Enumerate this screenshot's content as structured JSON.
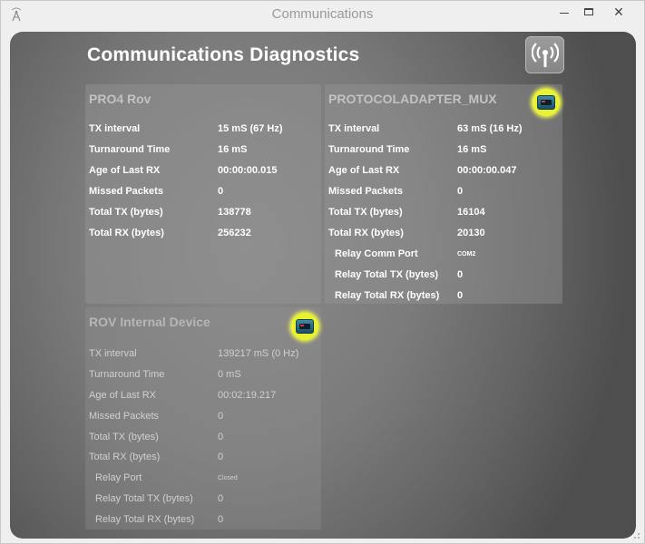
{
  "window": {
    "title": "Communications",
    "icons": {
      "app": "antenna-app-icon",
      "minimize": "minimize-icon",
      "maximize": "maximize-icon",
      "close": "close-icon"
    },
    "close_glyph": "✕"
  },
  "header": {
    "title": "Communications Diagnostics",
    "signal_icon": "wireless-signal-icon"
  },
  "panels": [
    {
      "title": "PRO4 Rov",
      "rows": [
        {
          "label": "TX interval",
          "value": "15 mS (67 Hz)"
        },
        {
          "label": "Turnaround Time",
          "value": "16 mS"
        },
        {
          "label": "Age of Last RX",
          "value": "00:00:00.015"
        },
        {
          "label": "Missed Packets",
          "value": "0"
        },
        {
          "label": "Total TX (bytes)",
          "value": "138778"
        },
        {
          "label": "Total RX (bytes)",
          "value": "256232"
        }
      ]
    },
    {
      "title": "PROTOCOLADAPTER_MUX",
      "terminal_icon": "terminal-icon",
      "rows": [
        {
          "label": "TX interval",
          "value": "63 mS (16 Hz)"
        },
        {
          "label": "Turnaround Time",
          "value": "16 mS"
        },
        {
          "label": "Age of Last RX",
          "value": "00:00:00.047"
        },
        {
          "label": "Missed Packets",
          "value": "0"
        },
        {
          "label": "Total TX (bytes)",
          "value": "16104"
        },
        {
          "label": "Total RX (bytes)",
          "value": "20130"
        },
        {
          "label": "Relay Comm Port",
          "value": "COM2"
        },
        {
          "label": "Relay Total TX (bytes)",
          "value": "0"
        },
        {
          "label": "Relay Total RX (bytes)",
          "value": "0"
        }
      ]
    },
    {
      "title": "ROV Internal Device",
      "terminal_icon": "terminal-icon",
      "rows": [
        {
          "label": "TX interval",
          "value": "139217 mS (0 Hz)"
        },
        {
          "label": "Turnaround Time",
          "value": "0 mS"
        },
        {
          "label": "Age of Last RX",
          "value": "00:02:19.217"
        },
        {
          "label": "Missed Packets",
          "value": "0"
        },
        {
          "label": "Total TX (bytes)",
          "value": "0"
        },
        {
          "label": "Total RX (bytes)",
          "value": "0"
        },
        {
          "label": "Relay Port",
          "value": "Closed"
        },
        {
          "label": "Relay Total TX (bytes)",
          "value": "0"
        },
        {
          "label": "Relay Total RX (bytes)",
          "value": "0"
        }
      ]
    }
  ]
}
